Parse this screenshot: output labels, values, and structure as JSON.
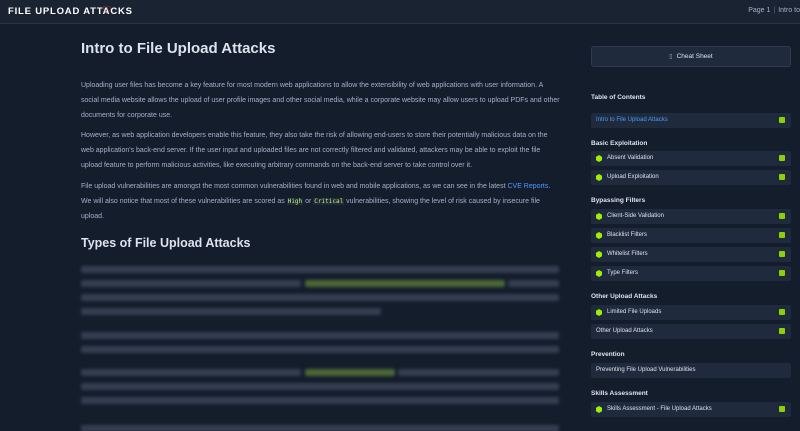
{
  "header": {
    "module_title": "FILE UPLOAD ATTACKS",
    "favorite_icon": "heart-icon",
    "page_indicator": "Page 1",
    "separator": "|",
    "current_section": "Intro to"
  },
  "content": {
    "title": "Intro to File Upload Attacks",
    "paragraph1": "Uploading user files has become a key feature for most modern web applications to allow the extensibility of web applications with user information. A social media website allows the upload of user profile images and other social media, while a corporate website may allow users to upload PDFs and other documents for corporate use.",
    "paragraph2": "However, as web application developers enable this feature, they also take the risk of allowing end-users to store their potentially malicious data on the web application's back-end server. If the user input and uploaded files are not correctly filtered and validated, attackers may be able to exploit the file upload feature to perform malicious activities, like executing arbitrary commands on the back-end server to take control over it.",
    "paragraph3_before_link": "File upload vulnerabilities are amongst the most common vulnerabilities found in web and mobile applications, as we can see in the latest ",
    "paragraph3_link": "CVE Reports",
    "paragraph3_mid1": ". We will also notice that most of these vulnerabilities are scored as ",
    "paragraph3_code1": "High",
    "paragraph3_mid2": " or ",
    "paragraph3_code2": "Critical",
    "paragraph3_after": " vulnerabilities, showing the level of risk caused by insecure file upload.",
    "section_title": "Types of File Upload Attacks"
  },
  "sidebar": {
    "cheat_sheet_label": "Cheat Sheet",
    "cheat_sheet_icon": "document-icon",
    "toc_title": "Table of Contents",
    "toc_intro": "Intro to File Upload Attacks",
    "groups": [
      {
        "title": "Basic Exploitation",
        "items": [
          "Absent Validation",
          "Upload Exploitation"
        ]
      },
      {
        "title": "Bypassing Filters",
        "items": [
          "Client-Side Validation",
          "Blacklist Filters",
          "Whitelist Filters",
          "Type Filters"
        ]
      },
      {
        "title": "Other Upload Attacks",
        "items": [
          "Limited File Uploads",
          "Other Upload Attacks"
        ]
      },
      {
        "title": "Prevention",
        "items": [
          "Preventing File Upload Vulnerabilities"
        ]
      },
      {
        "title": "Skills Assessment",
        "items": [
          "Skills Assessment - File Upload Attacks"
        ]
      }
    ],
    "accent_color": "#9fef00"
  }
}
